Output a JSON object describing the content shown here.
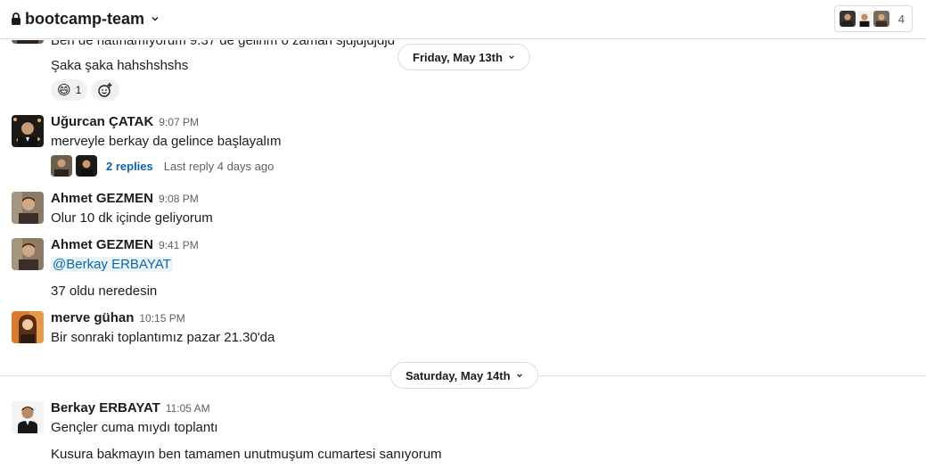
{
  "header": {
    "channel_name": "bootcamp-team",
    "member_count": "4"
  },
  "messages": {
    "partial_top_text": "Ben de hatırlamıyorum 9.37 de gelirim o zaman sjdjdjdjdjd",
    "m0_text": "Şaka şaka hahshshshs",
    "m0_reaction_emoji": "😄",
    "m0_reaction_count": "1",
    "m1": {
      "name": "Uğurcan ÇATAK",
      "time": "9:07 PM",
      "text": "merveyle berkay da gelince başlayalım",
      "replies": "2 replies",
      "last_reply": "Last reply 4 days ago"
    },
    "m2": {
      "name": "Ahmet GEZMEN",
      "time": "9:08 PM",
      "text": "Olur 10 dk içinde geliyorum"
    },
    "m3": {
      "name": "Ahmet GEZMEN",
      "time": "9:41 PM",
      "mention": "@Berkay ERBAYAT",
      "text": "37 oldu neredesin"
    },
    "m4": {
      "name": "merve gühan",
      "time": "10:15 PM",
      "text": "Bir sonraki toplantımız pazar 21.30'da"
    },
    "m5": {
      "name": "Berkay ERBAYAT",
      "time": "11:05 AM",
      "text1": "Gençler cuma mıydı toplantı",
      "text2": "Kusura bakmayın ben tamamen unutmuşum cumartesi sanıyorum"
    }
  },
  "dates": {
    "friday": "Friday, May 13th",
    "saturday": "Saturday, May 14th"
  },
  "icons": {
    "lock": "lock-icon",
    "chevron": "chevron-down-icon",
    "add_reaction": "add-reaction-icon"
  },
  "colors": {
    "link": "#1264a3",
    "mention_bg": "#e8f5fa",
    "muted": "#616061",
    "border": "#dddddd"
  }
}
